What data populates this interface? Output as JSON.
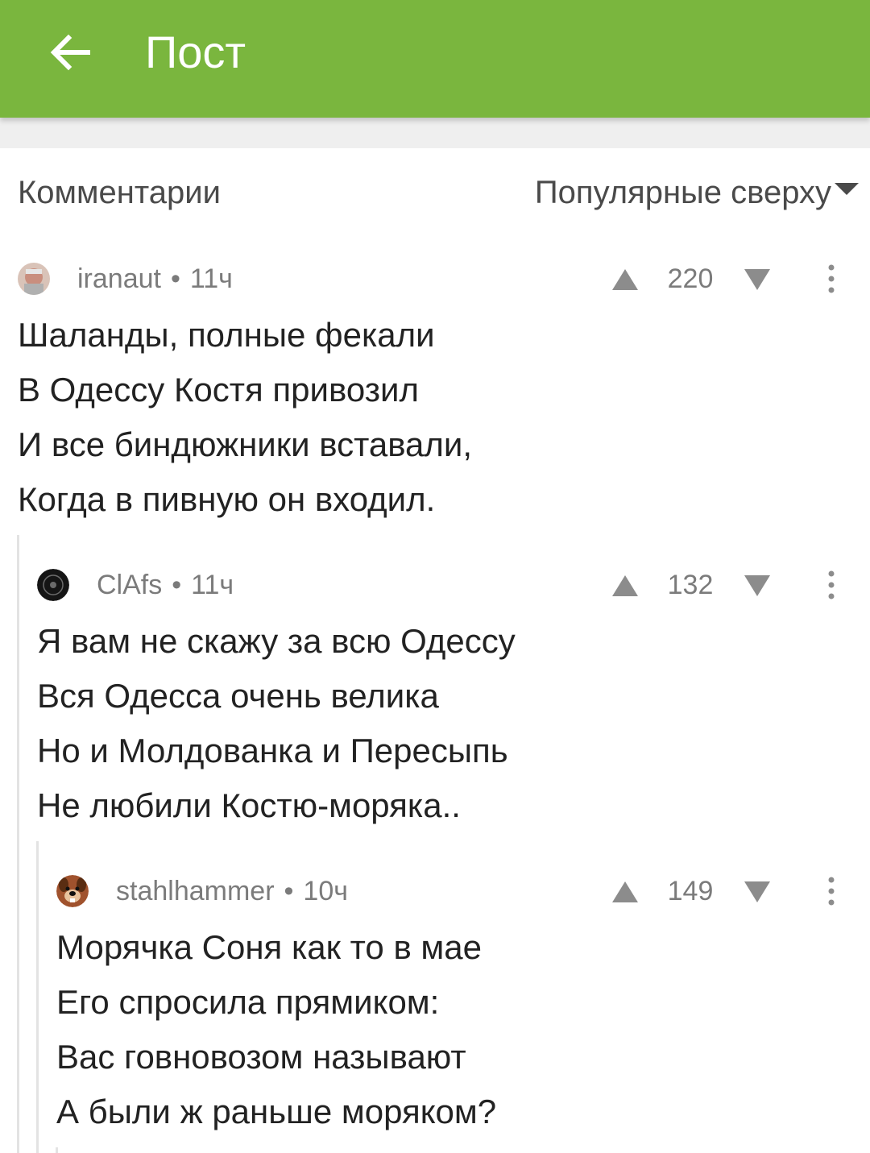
{
  "appbar": {
    "title": "Пост",
    "color": "#7ab63e",
    "back_icon": "arrow-left-icon"
  },
  "comments_section": {
    "title": "Комментарии",
    "sort_label": "Популярные сверху"
  },
  "comments": [
    {
      "author": "iranaut",
      "time": "11ч",
      "rating": "220",
      "avatar_icon": "user-avatar",
      "lines": [
        "Шаланды, полные фекали",
        "В Одессу Костя привозил",
        "И все биндюжники вставали,",
        "Когда в пивную он входил."
      ]
    },
    {
      "author": "ClAfs",
      "time": "11ч",
      "rating": "132",
      "avatar_icon": "emblem-avatar",
      "lines": [
        "Я вам не скажу за всю Одессу",
        "Вся Одесса очень велика",
        "Но и Молдованка и Пересыпь",
        "Не любили Костю-моряка.."
      ]
    },
    {
      "author": "stahlhammer",
      "time": "10ч",
      "rating": "149",
      "avatar_icon": "dog-avatar",
      "lines": [
        "Морячка Соня как то в мае",
        "Его спросила прямиком:",
        "Вас говновозом называют",
        "А были ж раньше моряком?"
      ]
    }
  ]
}
